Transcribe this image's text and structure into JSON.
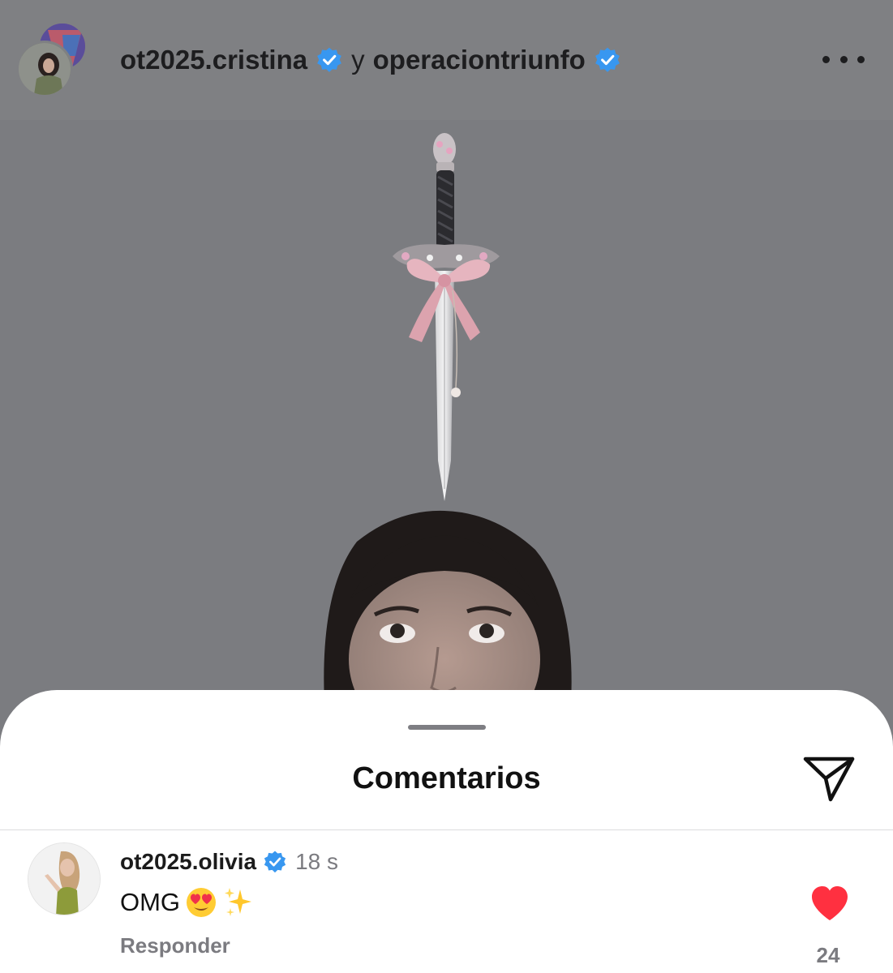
{
  "header": {
    "author_primary": "ot2025.cristina",
    "conjunction": "y",
    "author_secondary": "operaciontriunfo",
    "more_icon": "more-horizontal-icon",
    "verified_color": "#3897f0"
  },
  "post": {
    "image_icon": "post-photo-dagger-and-girl"
  },
  "comments_sheet": {
    "title": "Comentarios",
    "share_icon": "paper-plane-icon",
    "comments": [
      {
        "username": "ot2025.olivia",
        "time": "18 s",
        "text": "OMG",
        "emojis": [
          "heart-eyes-emoji",
          "sparkles-emoji"
        ],
        "reply_label": "Responder",
        "like_count": "24",
        "liked": true,
        "like_color": "#ff3040"
      }
    ]
  }
}
